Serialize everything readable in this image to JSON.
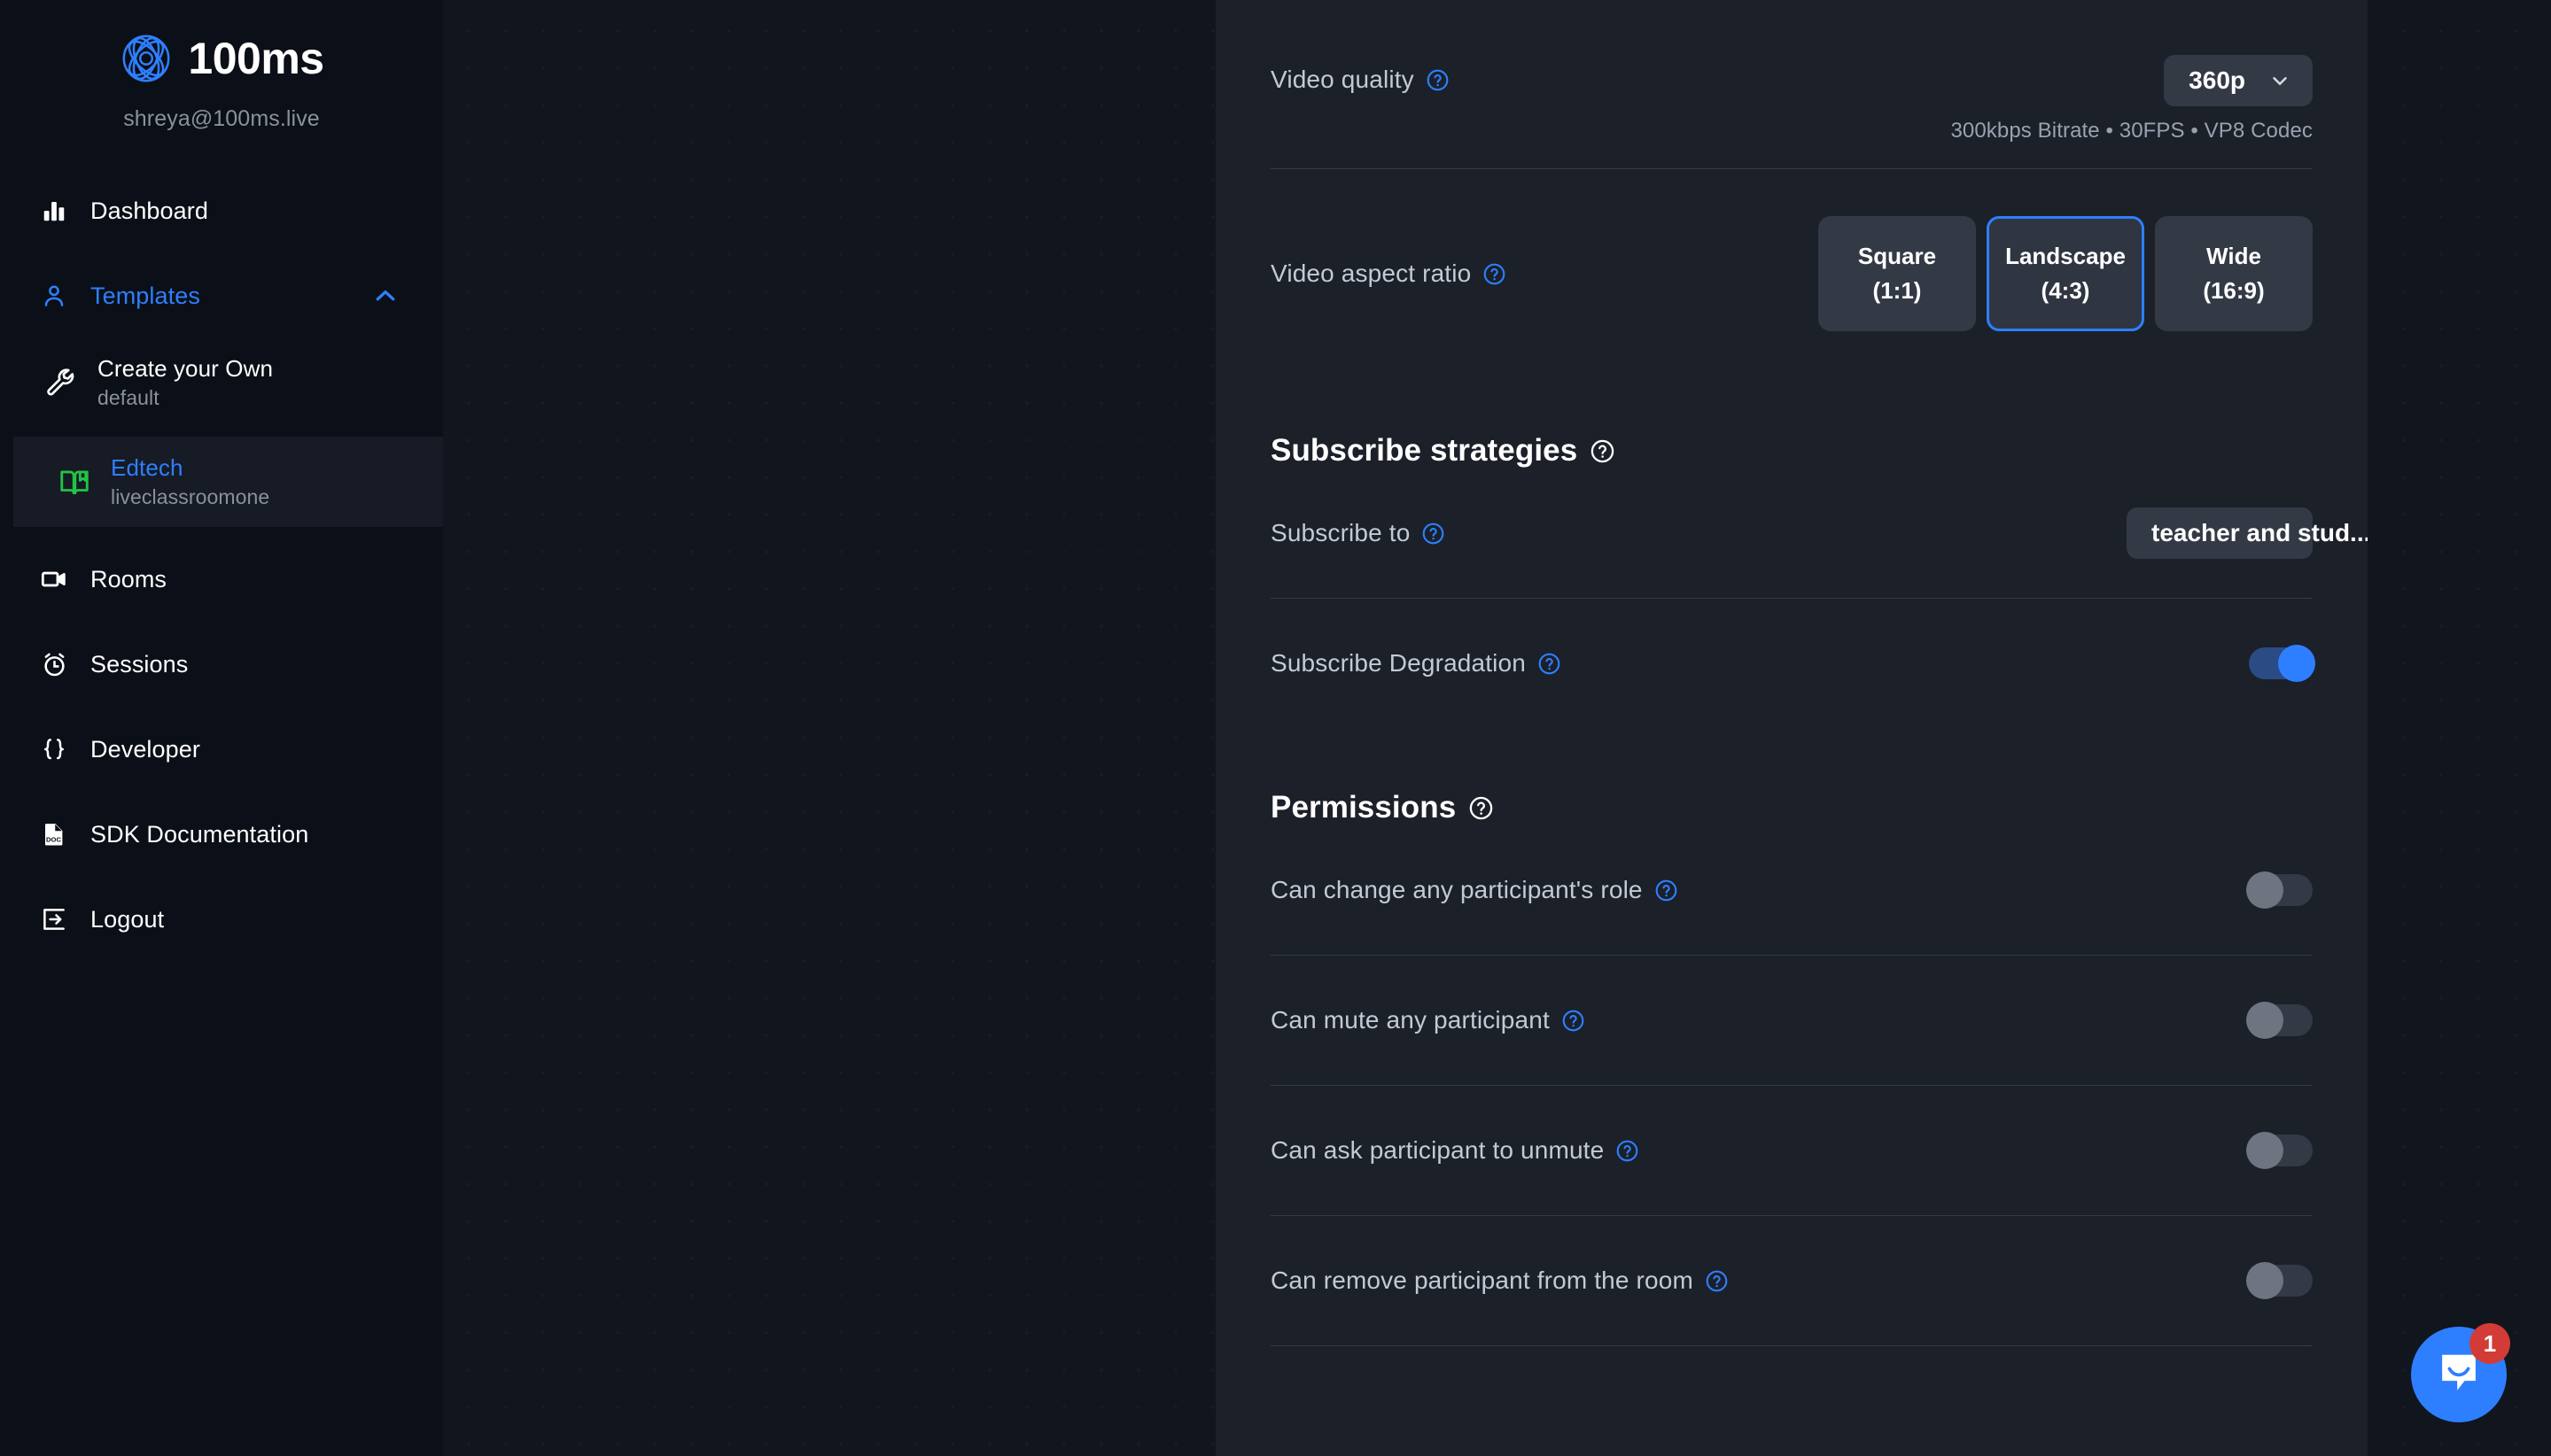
{
  "brand": {
    "name": "100ms",
    "logo_icon": "flower-logo-icon",
    "email": "shreya@100ms.live"
  },
  "sidebar": {
    "items": [
      {
        "label": "Dashboard",
        "icon": "bar-chart-icon",
        "name": "dashboard"
      },
      {
        "label": "Templates",
        "icon": "user-icon",
        "name": "templates",
        "accent": true,
        "chevron": "chevron-up-icon"
      },
      {
        "label": "Rooms",
        "icon": "video-camera-icon",
        "name": "rooms"
      },
      {
        "label": "Sessions",
        "icon": "alarm-clock-icon",
        "name": "sessions"
      },
      {
        "label": "Developer",
        "icon": "curly-braces-icon",
        "name": "developer"
      },
      {
        "label": "SDK Documentation",
        "icon": "doc-file-icon",
        "name": "sdk-documentation"
      },
      {
        "label": "Logout",
        "icon": "logout-arrow-icon",
        "name": "logout"
      }
    ],
    "templates": [
      {
        "title": "Create your Own",
        "subtitle": "default",
        "icon": "wrench-icon",
        "active": false
      },
      {
        "title": "Edtech",
        "subtitle": "liveclassroomone",
        "icon": "open-book-icon",
        "active": true
      }
    ]
  },
  "content": {
    "video_quality": {
      "label": "Video quality",
      "help_icon": "question-circle-icon",
      "selected": "360p",
      "chevron_icon": "chevron-down-icon",
      "meta": "300kbps Bitrate • 30FPS • VP8 Codec"
    },
    "video_aspect_ratio": {
      "label": "Video aspect ratio",
      "help_icon": "question-circle-icon",
      "options": [
        {
          "name": "Square",
          "ratio": "(1:1)",
          "selected": false
        },
        {
          "name": "Landscape",
          "ratio": "(4:3)",
          "selected": true
        },
        {
          "name": "Wide",
          "ratio": "(16:9)",
          "selected": false
        }
      ]
    },
    "subscribe_strategies": {
      "heading": "Subscribe strategies",
      "help_icon": "question-circle-icon",
      "subscribe_to": {
        "label": "Subscribe to",
        "help_icon": "question-circle-icon",
        "selected": "teacher and stud...",
        "chevron_icon": "chevron-down-icon"
      },
      "subscribe_degradation": {
        "label": "Subscribe Degradation",
        "help_icon": "question-circle-icon",
        "state": "on"
      }
    },
    "permissions": {
      "heading": "Permissions",
      "help_icon": "question-circle-icon",
      "rows": [
        {
          "label": "Can change any participant's role",
          "help_icon": "question-circle-icon",
          "state": "off"
        },
        {
          "label": "Can mute any participant",
          "help_icon": "question-circle-icon",
          "state": "off"
        },
        {
          "label": "Can ask participant to unmute",
          "help_icon": "question-circle-icon",
          "state": "off"
        },
        {
          "label": "Can remove participant from the room",
          "help_icon": "question-circle-icon",
          "state": "off"
        }
      ]
    }
  },
  "intercom": {
    "icon": "chat-bubble-smile-icon",
    "badge_count": "1"
  },
  "colors": {
    "accent_blue": "#2e7fff",
    "panel_bg": "#1b2029",
    "sidebar_bg": "#0b0f17",
    "badge_red": "#d33b36",
    "template_green": "#23c343"
  }
}
